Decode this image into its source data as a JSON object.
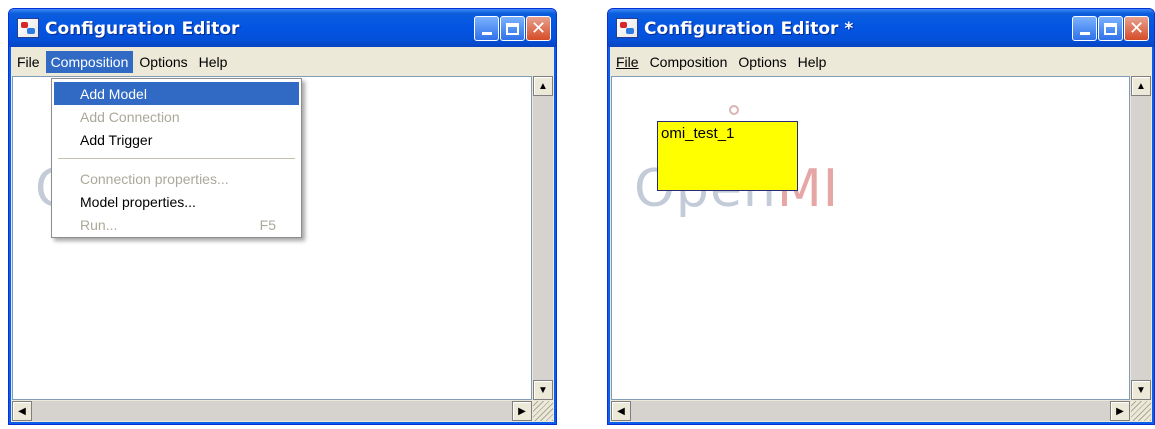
{
  "left_window": {
    "title": "Configuration Editor",
    "menu": [
      "File",
      "Composition",
      "Options",
      "Help"
    ],
    "active_menu": "Composition",
    "dropdown": {
      "items": [
        {
          "label": "Add Model",
          "state": "highlighted"
        },
        {
          "label": "Add Connection",
          "state": "disabled"
        },
        {
          "label": "Add Trigger",
          "state": "enabled"
        },
        {
          "label": "Connection properties...",
          "state": "disabled"
        },
        {
          "label": "Model properties...",
          "state": "enabled"
        },
        {
          "label": "Run...",
          "shortcut": "F5",
          "state": "disabled"
        }
      ]
    },
    "watermark": "C"
  },
  "right_window": {
    "title": "Configuration Editor *",
    "menu": [
      "File",
      "Composition",
      "Options",
      "Help"
    ],
    "model_label": "omi_test_1",
    "watermark_main": "Open",
    "watermark_accent": "MI"
  },
  "colors": {
    "title_bar": "#0454e4",
    "menu_highlight": "#316ac5",
    "model_fill": "#ffff00",
    "window_bg": "#ece9d8"
  },
  "icons": {
    "app": "config-editor-app-icon",
    "minimize": "minimize-icon",
    "maximize": "maximize-icon",
    "close": "close-icon",
    "scroll_up": "arrow-up-icon",
    "scroll_down": "arrow-down-icon",
    "scroll_left": "arrow-left-icon",
    "scroll_right": "arrow-right-icon"
  }
}
